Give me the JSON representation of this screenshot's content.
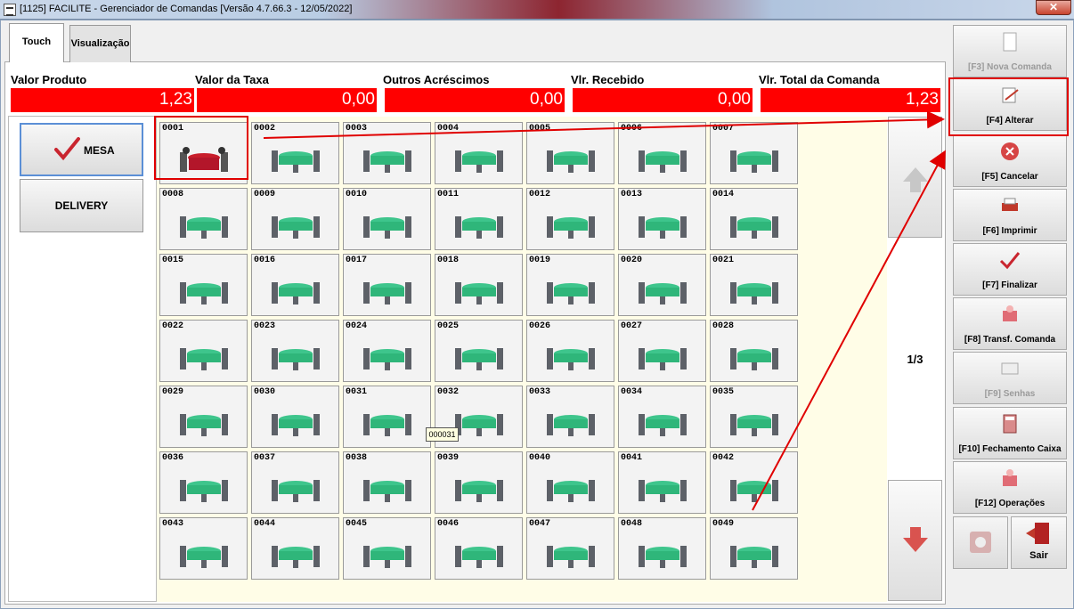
{
  "window": {
    "title": "[1125] FACILITE - Gerenciador de Comandas [Versão 4.7.66.3 - 12/05/2022]",
    "close": "✕"
  },
  "tabs": [
    {
      "label": "Touch"
    },
    {
      "label": "Visualização"
    }
  ],
  "values": [
    {
      "label": "Valor Produto",
      "value": "1,23"
    },
    {
      "label": "Valor da Taxa",
      "value": "0,00"
    },
    {
      "label": "Outros Acréscimos",
      "value": "0,00"
    },
    {
      "label": "Vlr. Recebido",
      "value": "0,00"
    },
    {
      "label": "Vlr. Total da Comanda",
      "value": "1,23"
    }
  ],
  "left_buttons": {
    "mesa": "MESA",
    "delivery": "DELIVERY"
  },
  "tables": [
    "0001",
    "0002",
    "0003",
    "0004",
    "0005",
    "0006",
    "0007",
    "0008",
    "0009",
    "0010",
    "0011",
    "0012",
    "0013",
    "0014",
    "0015",
    "0016",
    "0017",
    "0018",
    "0019",
    "0020",
    "0021",
    "0022",
    "0023",
    "0024",
    "0025",
    "0026",
    "0027",
    "0028",
    "0029",
    "0030",
    "0031",
    "0032",
    "0033",
    "0034",
    "0035",
    "0036",
    "0037",
    "0038",
    "0039",
    "0040",
    "0041",
    "0042",
    "0043",
    "0044",
    "0045",
    "0046",
    "0047",
    "0048",
    "0049"
  ],
  "occupied_table": "0001",
  "tooltip": "000031",
  "page_indicator": "1/3",
  "side_buttons": [
    {
      "label": "[F3] Nova Comanda",
      "icon": "new-document-icon",
      "enabled": false
    },
    {
      "label": "[F4] Alterar",
      "icon": "edit-icon",
      "enabled": true
    },
    {
      "label": "[F5] Cancelar",
      "icon": "cancel-icon",
      "enabled": true
    },
    {
      "label": "[F6] Imprimir",
      "icon": "printer-icon",
      "enabled": true
    },
    {
      "label": "[F7] Finalizar",
      "icon": "check-icon",
      "enabled": true
    },
    {
      "label": "[F8] Transf. Comanda",
      "icon": "transfer-icon",
      "enabled": true
    },
    {
      "label": "[F9] Senhas",
      "icon": "tickets-icon",
      "enabled": false
    },
    {
      "label": "[F10] Fechamento Caixa",
      "icon": "calculator-icon",
      "enabled": true
    },
    {
      "label": "[F12] Operações",
      "icon": "operations-icon",
      "enabled": true
    }
  ],
  "exit_button": "Sair",
  "colors": {
    "value_bg": "#ff0000",
    "table_green": "#2fb67a",
    "highlight": "#e00000",
    "accent_blue": "#5b8fd6"
  }
}
